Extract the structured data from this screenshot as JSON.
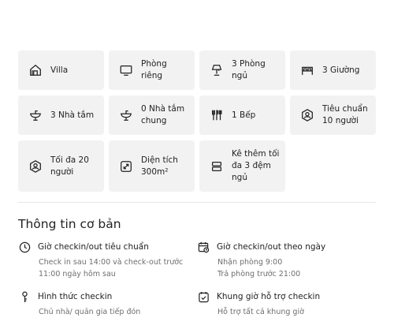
{
  "amenities": [
    {
      "icon": "villa-house-icon",
      "label": "Villa"
    },
    {
      "icon": "monitor-icon",
      "label": "Phòng riêng"
    },
    {
      "icon": "lamp-icon",
      "label": "3 Phòng ngủ"
    },
    {
      "icon": "bed-icon",
      "label": "3 Giường"
    },
    {
      "icon": "sink-icon",
      "label": "3 Nhà tắm"
    },
    {
      "icon": "shared-sink-icon",
      "label": "0 Nhà tắm chung"
    },
    {
      "icon": "kitchen-utensils-icon",
      "label": "1 Bếp"
    },
    {
      "icon": "guest-standard-icon",
      "label": "Tiêu chuẩn 10 người"
    },
    {
      "icon": "guest-max-icon",
      "label": "Tối đa 20 người"
    },
    {
      "icon": "area-resize-icon",
      "label": "Diện tích 300m²"
    },
    {
      "icon": "extra-mattress-icon",
      "label": "Kê thêm tối đa 3 đệm ngủ"
    }
  ],
  "basic_info": {
    "title": "Thông tin cơ bản",
    "items": [
      {
        "icon": "clock-icon",
        "title": "Giờ checkin/out tiêu chuẩn",
        "lines": [
          "Check in sau 14:00 và check-out trước",
          "11:00 ngày hôm sau"
        ]
      },
      {
        "icon": "calendar-clock-icon",
        "title": "Giờ checkin/out theo ngày",
        "lines": [
          "Nhận phòng 9:00",
          "Trả phòng trước 21:00"
        ]
      },
      {
        "icon": "key-icon",
        "title": "Hình thức checkin",
        "lines": [
          "Chủ nhà/ quản gia tiếp đón"
        ]
      },
      {
        "icon": "calendar-check-icon",
        "title": "Khung giờ hỗ trợ checkin",
        "lines": [
          "Hỗ trợ tất cả khung giờ"
        ]
      }
    ]
  }
}
